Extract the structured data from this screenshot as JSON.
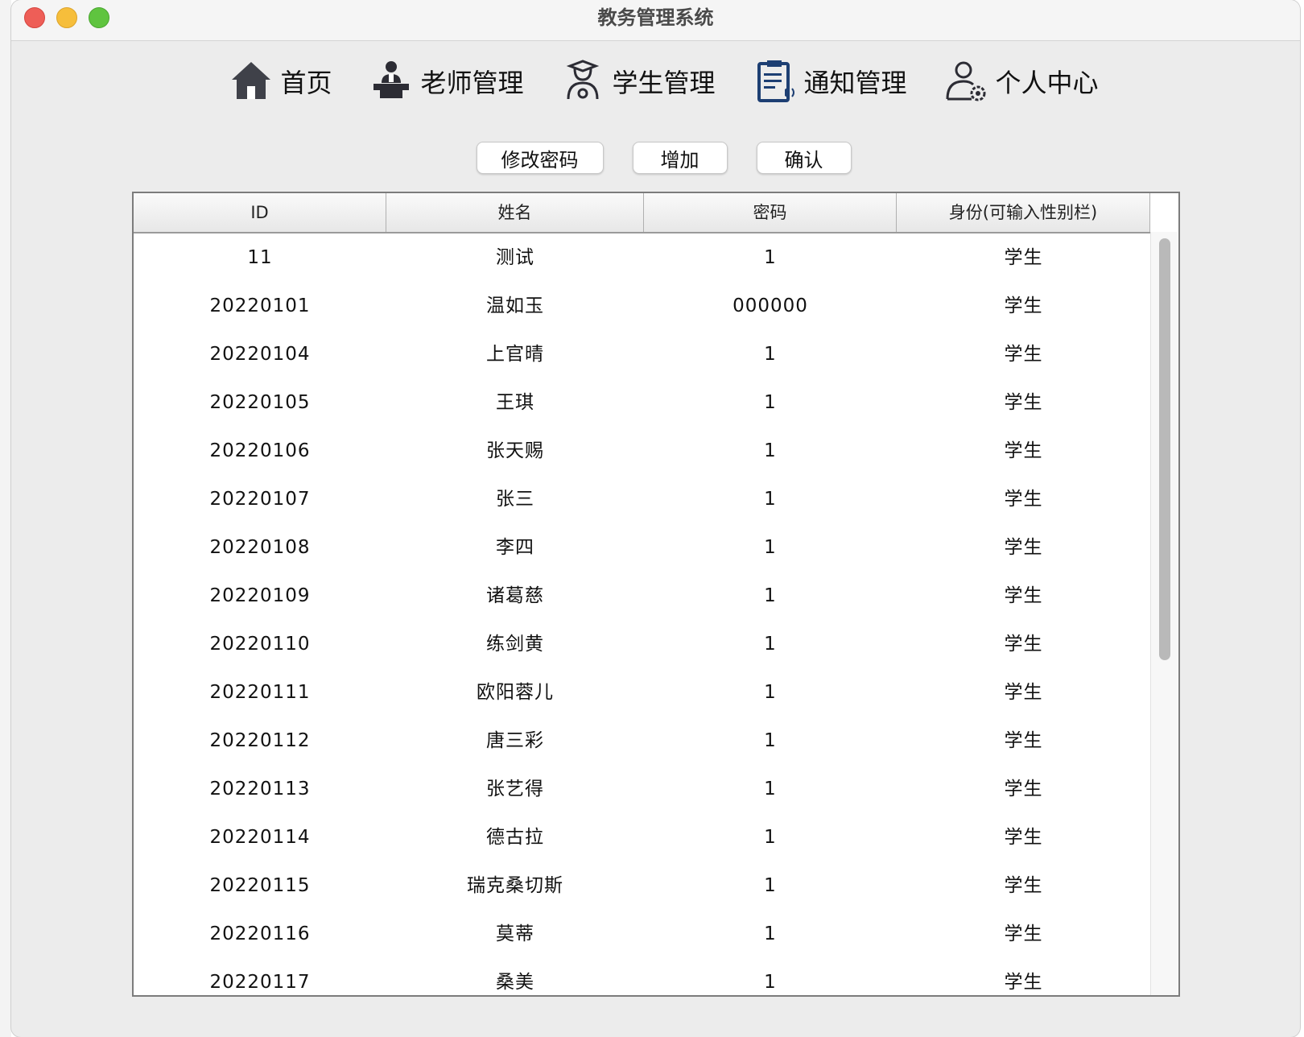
{
  "window": {
    "title": "教务管理系统"
  },
  "nav": [
    {
      "label": "首页",
      "icon": "home-icon"
    },
    {
      "label": "老师管理",
      "icon": "teacher-icon"
    },
    {
      "label": "学生管理",
      "icon": "student-icon"
    },
    {
      "label": "通知管理",
      "icon": "notice-icon"
    },
    {
      "label": "个人中心",
      "icon": "user-settings-icon"
    }
  ],
  "toolbar": {
    "change_password_label": "修改密码",
    "add_label": "增加",
    "confirm_label": "确认"
  },
  "table": {
    "columns": [
      "ID",
      "姓名",
      "密码",
      "身份(可输入性别栏)"
    ],
    "rows": [
      [
        "11",
        "测试",
        "1",
        "学生"
      ],
      [
        "20220101",
        "温如玉",
        "000000",
        "学生"
      ],
      [
        "20220104",
        "上官晴",
        "1",
        "学生"
      ],
      [
        "20220105",
        "王琪",
        "1",
        "学生"
      ],
      [
        "20220106",
        "张天赐",
        "1",
        "学生"
      ],
      [
        "20220107",
        "张三",
        "1",
        "学生"
      ],
      [
        "20220108",
        "李四",
        "1",
        "学生"
      ],
      [
        "20220109",
        "诸葛慈",
        "1",
        "学生"
      ],
      [
        "20220110",
        "练剑黄",
        "1",
        "学生"
      ],
      [
        "20220111",
        "欧阳蓉儿",
        "1",
        "学生"
      ],
      [
        "20220112",
        "唐三彩",
        "1",
        "学生"
      ],
      [
        "20220113",
        "张艺得",
        "1",
        "学生"
      ],
      [
        "20220114",
        "德古拉",
        "1",
        "学生"
      ],
      [
        "20220115",
        "瑞克桑切斯",
        "1",
        "学生"
      ],
      [
        "20220116",
        "莫蒂",
        "1",
        "学生"
      ],
      [
        "20220117",
        "桑美",
        "1",
        "学生"
      ]
    ]
  },
  "colors": {
    "window_bg": "#ececec",
    "table_border": "#7c7c7c",
    "icon_dark": "#3f4149",
    "icon_blue": "#1d3f73"
  }
}
